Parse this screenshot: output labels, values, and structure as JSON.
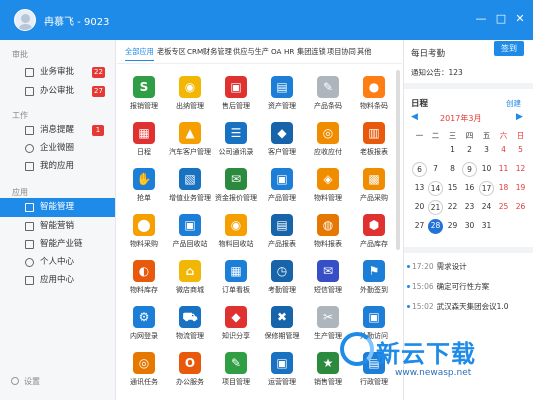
{
  "window": {
    "title": "冉慕飞 - 9023",
    "controls": [
      "—",
      "□",
      "✕"
    ]
  },
  "sidebar": {
    "sections": [
      {
        "label": "审批",
        "items": [
          {
            "label": "业务审批",
            "badge": "22"
          },
          {
            "label": "办公审批",
            "badge": "27"
          }
        ]
      },
      {
        "label": "工作",
        "items": [
          {
            "label": "消息提醒",
            "badge": "1"
          },
          {
            "label": "企业微圈",
            "badge": ""
          },
          {
            "label": "我的应用",
            "badge": ""
          }
        ]
      },
      {
        "label": "应用",
        "items": [
          {
            "label": "智能管理",
            "badge": ""
          },
          {
            "label": "智能营销",
            "badge": ""
          },
          {
            "label": "智能产业链",
            "badge": ""
          },
          {
            "label": "个人中心",
            "badge": ""
          },
          {
            "label": "应用中心",
            "badge": ""
          }
        ]
      }
    ],
    "active": "智能管理",
    "settings": "设置"
  },
  "tabs": [
    "全部应用",
    "老板专区",
    "CRM",
    "财务管理",
    "供应与生产",
    "OA",
    "HR",
    "集团连锁",
    "项目协同",
    "其他"
  ],
  "active_tab": "全部应用",
  "apps": [
    {
      "label": "报销管理",
      "icon": "S",
      "color": "#2f9e44"
    },
    {
      "label": "出纳管理",
      "icon": "◉",
      "color": "#f2b705"
    },
    {
      "label": "售后管理",
      "icon": "▣",
      "color": "#e03131"
    },
    {
      "label": "资产管理",
      "icon": "▤",
      "color": "#1c7ed6"
    },
    {
      "label": "产品条码",
      "icon": "✎",
      "color": "#adb5bd"
    },
    {
      "label": "物料条码",
      "icon": "●",
      "color": "#fd7e14"
    },
    {
      "label": "日程",
      "icon": "▦",
      "color": "#e03131"
    },
    {
      "label": "汽车客户管理",
      "icon": "▲",
      "color": "#f59f00"
    },
    {
      "label": "公司通讯录",
      "icon": "☰",
      "color": "#1971c2"
    },
    {
      "label": "客户管理",
      "icon": "◆",
      "color": "#1864ab"
    },
    {
      "label": "应收应付",
      "icon": "◎",
      "color": "#f08c00"
    },
    {
      "label": "老板报表",
      "icon": "▥",
      "color": "#e8590c"
    },
    {
      "label": "抢单",
      "icon": "✋",
      "color": "#1c7ed6"
    },
    {
      "label": "增值业务管理",
      "icon": "▧",
      "color": "#1971c2"
    },
    {
      "label": "资金报价管理",
      "icon": "✉",
      "color": "#2b8a3e"
    },
    {
      "label": "产品管理",
      "icon": "▣",
      "color": "#1c7ed6"
    },
    {
      "label": "物料管理",
      "icon": "◈",
      "color": "#f08c00"
    },
    {
      "label": "产品采购",
      "icon": "▩",
      "color": "#f08c00"
    },
    {
      "label": "物料采购",
      "icon": "⬤",
      "color": "#f59f00"
    },
    {
      "label": "产品回收站",
      "icon": "▣",
      "color": "#1c7ed6"
    },
    {
      "label": "物料回收站",
      "icon": "◉",
      "color": "#f59f00"
    },
    {
      "label": "产品报表",
      "icon": "▤",
      "color": "#1864ab"
    },
    {
      "label": "物料报表",
      "icon": "◍",
      "color": "#e67700"
    },
    {
      "label": "产品库存",
      "icon": "⬢",
      "color": "#e03131"
    },
    {
      "label": "物料库存",
      "icon": "◐",
      "color": "#e8590c"
    },
    {
      "label": "微店商城",
      "icon": "⌂",
      "color": "#f2b705"
    },
    {
      "label": "订单看板",
      "icon": "▦",
      "color": "#1c7ed6"
    },
    {
      "label": "考勤管理",
      "icon": "◷",
      "color": "#1864ab"
    },
    {
      "label": "短信管理",
      "icon": "✉",
      "color": "#364fc7"
    },
    {
      "label": "外勤签到",
      "icon": "⚑",
      "color": "#1c7ed6"
    },
    {
      "label": "内网登录",
      "icon": "⚙",
      "color": "#1c7ed6"
    },
    {
      "label": "物流管理",
      "icon": "⛟",
      "color": "#1971c2"
    },
    {
      "label": "知识分享",
      "icon": "◆",
      "color": "#e03131"
    },
    {
      "label": "保修期管理",
      "icon": "✖",
      "color": "#1864ab"
    },
    {
      "label": "生产管理",
      "icon": "✂",
      "color": "#adb5bd"
    },
    {
      "label": "外勤访问",
      "icon": "▣",
      "color": "#1c7ed6"
    },
    {
      "label": "通讯任务",
      "icon": "◎",
      "color": "#e67700"
    },
    {
      "label": "办公服务",
      "icon": "O",
      "color": "#e8590c"
    },
    {
      "label": "项目管理",
      "icon": "✎",
      "color": "#2f9e44"
    },
    {
      "label": "运营管理",
      "icon": "▣",
      "color": "#1971c2"
    },
    {
      "label": "销售管理",
      "icon": "★",
      "color": "#2b8a3e"
    },
    {
      "label": "行政管理",
      "icon": "▤",
      "color": "#1c7ed6"
    }
  ],
  "right": {
    "attendance": "每日考勤",
    "sign_button": "签到",
    "notice": "通知公告：123",
    "calendar": {
      "title": "日程",
      "create": "创建",
      "month": "2017年3月",
      "weekdays": [
        "一",
        "二",
        "三",
        "四",
        "五",
        "六",
        "日"
      ],
      "weeks": [
        [
          "",
          "",
          "1",
          "2",
          "3",
          "4",
          "5"
        ],
        [
          "6",
          "7",
          "8",
          "9",
          "10",
          "11",
          "12"
        ],
        [
          "13",
          "14",
          "15",
          "16",
          "17",
          "18",
          "19"
        ],
        [
          "20",
          "21",
          "22",
          "23",
          "24",
          "25",
          "26"
        ],
        [
          "27",
          "28",
          "29",
          "30",
          "31",
          "",
          ""
        ]
      ],
      "today": "28",
      "circled": [
        "6",
        "9",
        "14",
        "17",
        "21"
      ]
    },
    "timeline": [
      {
        "time": "17:20",
        "text": "需求设计"
      },
      {
        "time": "15:06",
        "text": "确定可行性方案"
      },
      {
        "time": "15:02",
        "text": "武汉森天集团会议1.0"
      }
    ]
  },
  "watermark": {
    "text": "新云下载",
    "url": "www.newasp.net"
  }
}
